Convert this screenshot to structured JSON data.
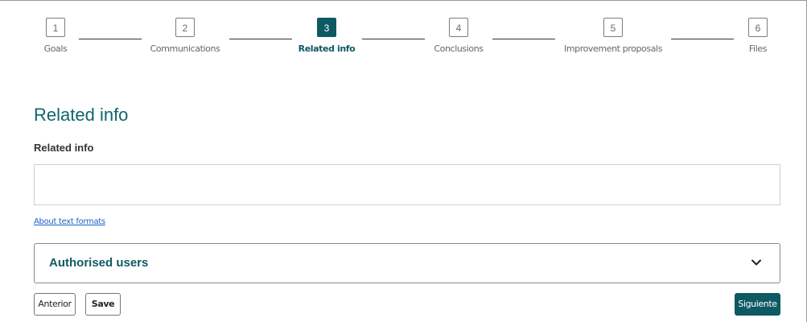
{
  "stepper": {
    "steps": [
      {
        "number": "1",
        "label": "Goals",
        "active": false
      },
      {
        "number": "2",
        "label": "Communications",
        "active": false
      },
      {
        "number": "3",
        "label": "Related info",
        "active": true
      },
      {
        "number": "4",
        "label": "Conclusions",
        "active": false
      },
      {
        "number": "5",
        "label": "Improvement proposals",
        "active": false
      },
      {
        "number": "6",
        "label": "Files",
        "active": false
      }
    ],
    "current_step": 3
  },
  "section": {
    "title": "Related info",
    "field_label": "Related info",
    "field_value": "",
    "help_link": "About text formats"
  },
  "accordion": {
    "title": "Authorised users",
    "icon": "chevron-down-icon",
    "expanded": false
  },
  "actions": {
    "previous_label": "Anterior",
    "save_label": "Save",
    "next_label": "Siguiente"
  },
  "colors": {
    "accent": "#0e5a63",
    "heading": "#11656d",
    "link": "#1a62c9"
  }
}
